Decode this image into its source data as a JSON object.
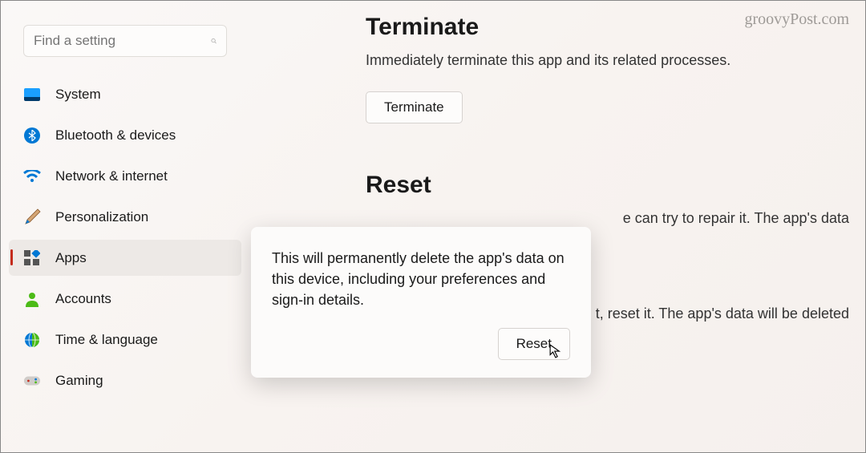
{
  "watermark": "groovyPost.com",
  "search": {
    "placeholder": "Find a setting"
  },
  "sidebar": {
    "items": [
      {
        "label": "System"
      },
      {
        "label": "Bluetooth & devices"
      },
      {
        "label": "Network & internet"
      },
      {
        "label": "Personalization"
      },
      {
        "label": "Apps"
      },
      {
        "label": "Accounts"
      },
      {
        "label": "Time & language"
      },
      {
        "label": "Gaming"
      }
    ]
  },
  "terminate": {
    "title": "Terminate",
    "desc": "Immediately terminate this app and its related processes.",
    "button": "Terminate"
  },
  "reset": {
    "title": "Reset",
    "repair_desc_fragment": "e can try to repair it. The app's data",
    "reset_desc_fragment": "t, reset it. The app's data will be deleted",
    "button": "Reset"
  },
  "tooltip": {
    "text": "This will permanently delete the app's data on this device, including your preferences and sign-in details.",
    "button": "Reset"
  }
}
